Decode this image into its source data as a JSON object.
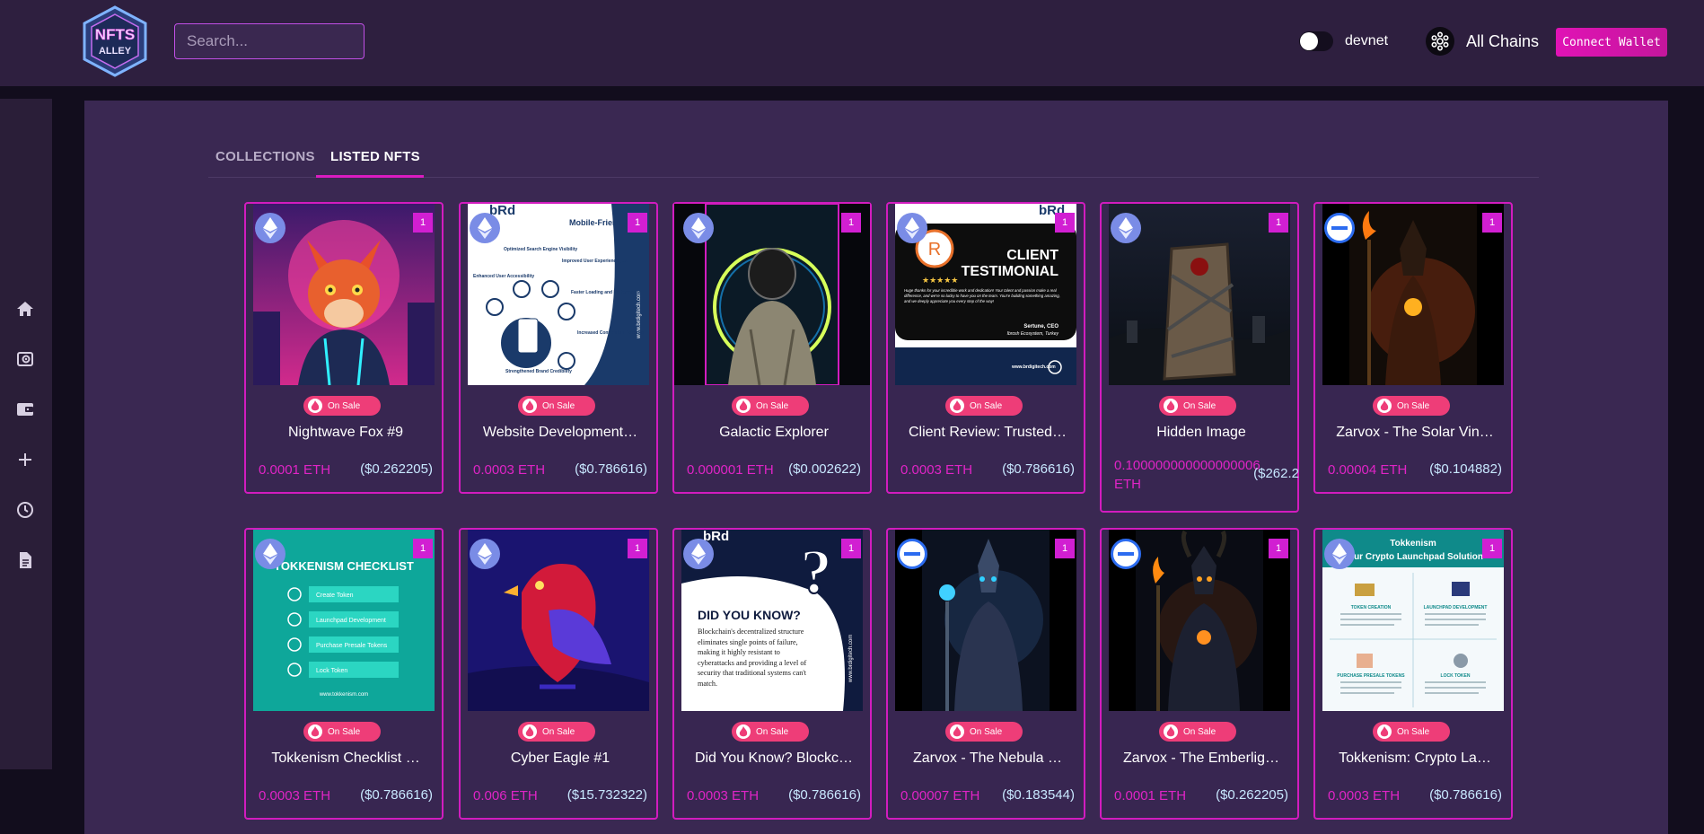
{
  "header": {
    "logo_text": "NFTS ALLEY",
    "search_placeholder": "Search...",
    "network_label": "devnet",
    "chain_label": "All Chains",
    "connect_button": "Connect Wallet"
  },
  "sidebar": {
    "items": [
      "home-icon",
      "explore-icon",
      "wallet-icon",
      "add-icon",
      "history-icon",
      "document-icon"
    ]
  },
  "tabs": [
    {
      "label": "COLLECTIONS",
      "active": false
    },
    {
      "label": "LISTED NFTS",
      "active": true
    }
  ],
  "sale_label": "On Sale",
  "cards": [
    {
      "title": "Nightwave Fox #9",
      "eth": "0.0001 ETH",
      "usd": "($0.262205)",
      "chain": "eth",
      "count": "1"
    },
    {
      "title": "Website Development…",
      "eth": "0.0003 ETH",
      "usd": "($0.786616)",
      "chain": "eth",
      "count": "1"
    },
    {
      "title": "Galactic Explorer",
      "eth": "0.000001 ETH",
      "usd": "($0.002622)",
      "chain": "eth",
      "count": "1"
    },
    {
      "title": "Client Review: Trusted…",
      "eth": "0.0003 ETH",
      "usd": "($0.786616)",
      "chain": "eth",
      "count": "1"
    },
    {
      "title": "Hidden Image",
      "eth": "0.100000000000000006 ETH",
      "usd": "($262.2",
      "chain": "eth",
      "count": "1"
    },
    {
      "title": "Zarvox - The Solar Vin…",
      "eth": "0.00004 ETH",
      "usd": "($0.104882)",
      "chain": "sol",
      "count": "1"
    },
    {
      "title": "Tokkenism Checklist …",
      "eth": "0.0003 ETH",
      "usd": "($0.786616)",
      "chain": "eth",
      "count": "1"
    },
    {
      "title": "Cyber Eagle #1",
      "eth": "0.006 ETH",
      "usd": "($15.732322)",
      "chain": "eth",
      "count": "1"
    },
    {
      "title": "Did You Know? Blockc…",
      "eth": "0.0003 ETH",
      "usd": "($0.786616)",
      "chain": "eth",
      "count": "1"
    },
    {
      "title": "Zarvox - The Nebula …",
      "eth": "0.00007 ETH",
      "usd": "($0.183544)",
      "chain": "sol",
      "count": "1"
    },
    {
      "title": "Zarvox - The Emberlig…",
      "eth": "0.0001 ETH",
      "usd": "($0.262205)",
      "chain": "sol",
      "count": "1"
    },
    {
      "title": "Tokkenism: Crypto La…",
      "eth": "0.0003 ETH",
      "usd": "($0.786616)",
      "chain": "eth",
      "count": "1"
    }
  ],
  "thumbnails": {
    "t1": {
      "brand": "bRd",
      "heading": "Mobile-Friendly Websites",
      "side": "www.brdigitech.com",
      "items": [
        "Optimized Search Engine Visibility",
        "Improved User Experience (UX)",
        "Enhanced User Accessibility",
        "Faster Loading and Performance",
        "Increased Conversion Potential",
        "Strengthened Brand Credibility"
      ]
    },
    "t3": {
      "brand": "bRd",
      "heading1": "CLIENT",
      "heading2": "TESTIMONIAL",
      "stars": "★★★★★",
      "quote": "Huge thanks for your incredible work and dedication! Your talent and passion make a real difference, and we're so lucky to have you on the team. You're building something amazing, and we deeply appreciate you every step of the way!",
      "author": "Sertune, CEO",
      "company": "Ibrosh Ecosystem, Turkey",
      "site": "www.brdigitech.com"
    },
    "t6": {
      "heading": "TOKKENISM CHECKLIST",
      "items": [
        "Create Token",
        "Launchpad Development",
        "Purchase Presale Tokens",
        "Lock Token"
      ],
      "site": "www.tokkenism.com"
    },
    "t8": {
      "brand": "bRd",
      "heading": "DID YOU KNOW?",
      "body": "Blockchain's decentralized structure eliminates single points of failure, making it highly resistant to cyberattacks and providing a level of security that traditional systems can't match.",
      "side": "www.brdigitech.com"
    },
    "t11": {
      "heading1": "Tokkenism",
      "heading2": "Your Crypto Launchpad Solution",
      "cells": [
        "TOKEN CREATION",
        "LAUNCHPAD DEVELOPMENT",
        "PURCHASE PRESALE TOKENS",
        "LOCK TOKEN"
      ]
    }
  },
  "colors": {
    "accent": "#d21cbf",
    "header_bg": "#2e1f3f",
    "panel_bg": "#3a2852",
    "price": "#e024c6",
    "usd": "#c8e8ff",
    "sale": "#ee3d78"
  }
}
